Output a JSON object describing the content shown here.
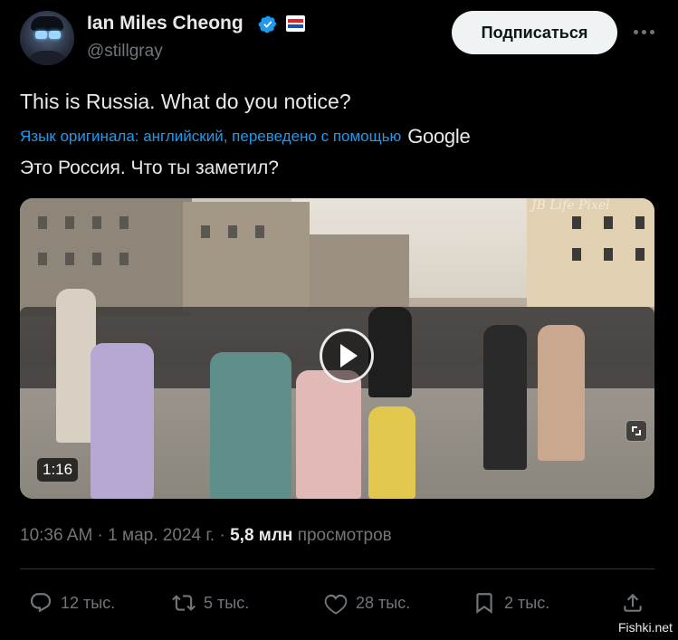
{
  "author": {
    "name": "Ian Miles Cheong",
    "handle": "@stillgray"
  },
  "header": {
    "subscribe_label": "Подписаться",
    "more_icon": "more-dots-icon",
    "verified_color": "#1d9bf0"
  },
  "tweet": {
    "text": "This is Russia. What do you notice?",
    "translation_note": "Язык оригинала: английский, переведено с помощью",
    "translation_provider": "Google",
    "translated_text": "Это Россия. Что ты заметил?"
  },
  "video": {
    "duration": "1:16",
    "watermark": "JB Life Pixel",
    "play_icon": "play-icon",
    "expand_icon": "expand-icon"
  },
  "meta": {
    "time": "10:36 AM",
    "sep1": " · ",
    "date": "1 мар. 2024 г.",
    "sep2": " · ",
    "views_count": "5,8 млн",
    "views_label": "просмотров"
  },
  "actions": {
    "replies": "12 тыс.",
    "retweets": "5 тыс.",
    "likes": "28 тыс.",
    "bookmarks": "2 тыс."
  },
  "footer": {
    "source_watermark": "Fishki.net"
  },
  "colors": {
    "background": "#000000",
    "text": "#e7e9ea",
    "muted": "#71767b",
    "accent": "#1d9bf0"
  }
}
